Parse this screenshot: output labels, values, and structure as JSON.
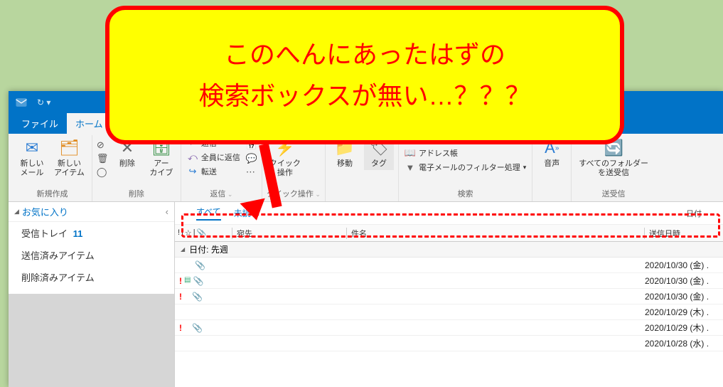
{
  "annotation": {
    "line1": "このへんにあったはずの",
    "line2": "検索ボックスが無い…？？？"
  },
  "tabs": {
    "file": "ファイル",
    "home": "ホーム"
  },
  "ribbon": {
    "new_group": {
      "new_mail": "新しい\nメール",
      "new_item": "新しい\nアイテム",
      "label": "新規作成"
    },
    "delete_group": {
      "delete": "削除",
      "archive": "アー\nカイブ",
      "label": "削除"
    },
    "respond_group": {
      "reply": "返信",
      "reply_all": "全員に返信",
      "forward": "転送",
      "big_forward": "返信",
      "label": "返信"
    },
    "quick_group": {
      "quick": "クイック\n操作",
      "label": "クイック操作"
    },
    "move_group": {
      "move": "移動",
      "tag": "タグ",
      "label": ""
    },
    "find_group": {
      "address_book": "アドレス帳",
      "filter_email": "電子メールのフィルター処理",
      "label": "検索"
    },
    "voice_group": {
      "voice": "音声",
      "label": ""
    },
    "sendrec_group": {
      "sr": "すべてのフォルダー\nを送受信",
      "label": "送受信"
    }
  },
  "nav": {
    "favorites": "お気に入り",
    "inbox": "受信トレイ",
    "inbox_count": "11",
    "sent": "送信済みアイテム",
    "deleted": "削除済みアイテム"
  },
  "filter": {
    "all": "すべて",
    "unread": "未読",
    "right": "日付"
  },
  "cols": {
    "from": "宛先",
    "subject": "件名",
    "date": "送信日時",
    "icon_flag_tip": "!",
    "icon_reminder_tip": "⏰",
    "icon_attach_tip": "📎"
  },
  "group": {
    "last_week": "日付: 先週"
  },
  "rows": [
    {
      "important": false,
      "cat": false,
      "attach": true,
      "date": "2020/10/30 (金) ."
    },
    {
      "important": true,
      "cat": true,
      "attach": true,
      "date": "2020/10/30 (金) ."
    },
    {
      "important": true,
      "cat": false,
      "attach": true,
      "date": "2020/10/30 (金) ."
    },
    {
      "important": false,
      "cat": false,
      "attach": false,
      "date": "2020/10/29 (木) ."
    },
    {
      "important": true,
      "cat": false,
      "attach": true,
      "date": "2020/10/29 (木) ."
    },
    {
      "important": false,
      "cat": false,
      "attach": false,
      "date": "2020/10/28 (水) ."
    }
  ]
}
